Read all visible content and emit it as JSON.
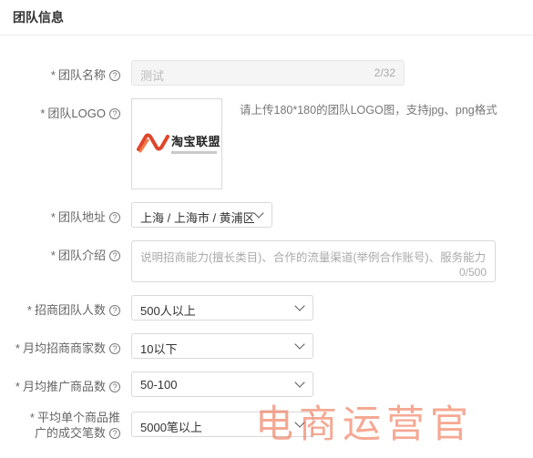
{
  "header": {
    "title": "团队信息"
  },
  "fields": {
    "name": {
      "label": "团队名称",
      "value": "测试",
      "count": "2/32"
    },
    "logo": {
      "label": "团队LOGO",
      "hint": "请上传180*180的团队LOGO图，支持jpg、png格式",
      "logo_text": "淘宝联盟"
    },
    "address": {
      "label": "团队地址",
      "value": "上海 / 上海市 / 黄浦区"
    },
    "intro": {
      "label": "团队介绍",
      "placeholder": "说明招商能力(擅长类目)、合作的流量渠道(举例合作账号)、服务能力",
      "count": "0/500"
    },
    "team_size": {
      "label": "招商团队人数",
      "value": "500人以上"
    },
    "monthly_merchants": {
      "label": "月均招商商家数",
      "value": "10以下"
    },
    "monthly_products": {
      "label": "月均推广商品数",
      "value": "50-100"
    },
    "avg_orders": {
      "label_line1": "平均单个商品推",
      "label_line2": "广的成交笔数",
      "value": "5000笔以上"
    }
  },
  "watermark": "电商运营官",
  "colors": {
    "logo_accent": "#e0452c"
  }
}
